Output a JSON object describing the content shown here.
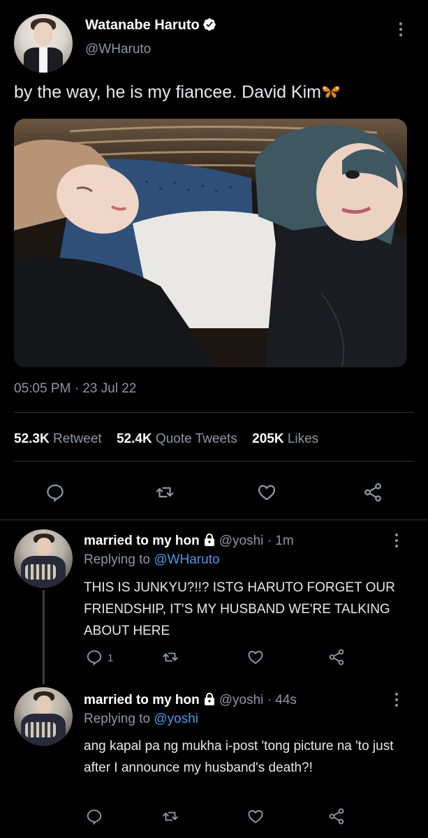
{
  "tweet": {
    "author": {
      "name": "Watanabe Haruto",
      "handle": "@WHaruto"
    },
    "text": "by the way, he is my fiancee. David Kim",
    "timestamp": "05:05 PM · 23 Jul 22",
    "stats": {
      "retweets_count": "52.3K",
      "retweets_label": "Retweet",
      "quotes_count": "52.4K",
      "quotes_label": "Quote Tweets",
      "likes_count": "205K",
      "likes_label": "Likes"
    }
  },
  "replies": [
    {
      "name": "married to my hon",
      "handle": "@yoshi",
      "time": "· 1m",
      "replying_label": "Replying to",
      "replying_to": "@WHaruto",
      "text": "THIS IS JUNKYU?!!? ISTG HARUTO FORGET OUR FRIENDSHIP, IT'S MY HUSBAND WE'RE TALKING ABOUT HERE",
      "reply_count": "1"
    },
    {
      "name": "married to my hon",
      "handle": "@yoshi",
      "time": "· 44s",
      "replying_label": "Replying to",
      "replying_to": "@yoshi",
      "text": "ang kapal pa ng mukha i-post 'tong picture na 'to just after I announce my husband's death?!",
      "reply_count": ""
    }
  ],
  "icons": {
    "reply": "reply-icon",
    "retweet": "retweet-icon",
    "like": "heart-icon",
    "share": "share-icon",
    "verified": "verified-badge-icon",
    "lock": "lock-icon",
    "more": "more-vertical-icon",
    "emoji": "butterfly-emoji"
  },
  "colors": {
    "background": "#000000",
    "text": "#e7e9ea",
    "muted": "#8b98a5",
    "link": "#4a99e9",
    "divider": "#2f3336"
  }
}
